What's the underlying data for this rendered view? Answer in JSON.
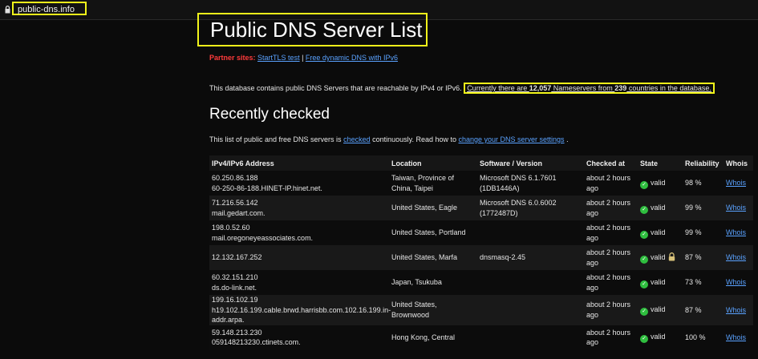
{
  "browser": {
    "url": "public-dns.info"
  },
  "page": {
    "title": "Public DNS Server List",
    "partners_label": "Partner sites:",
    "partner1": "StartTLS test",
    "partner_sep": " | ",
    "partner2": "Free dynamic DNS with IPv6",
    "intro": "This database contains public DNS Servers that are reachable by IPv4 or IPv6.",
    "count_prefix": "Currently there are ",
    "count_servers": "12,057",
    "count_mid": " Nameservers from ",
    "count_countries": "239",
    "count_suffix": " countries in the database.",
    "recent_heading": "Recently checked",
    "desc_prefix": "This list of public and free DNS servers is ",
    "desc_link1": "checked",
    "desc_mid": " continuously. Read how to ",
    "desc_link2": "change your DNS server settings",
    "desc_suffix": " ."
  },
  "table": {
    "headers": [
      "IPv4/IPv6 Address",
      "Location",
      "Software / Version",
      "Checked at",
      "State",
      "Reliability",
      "Whois"
    ],
    "rows": [
      {
        "ip": "60.250.86.188",
        "host": "60-250-86-188.HINET-IP.hinet.net.",
        "location": "Taiwan, Province of China, Taipei",
        "software": "Microsoft DNS 6.1.7601 (1DB1446A)",
        "checked": "about 2 hours ago",
        "state": "valid",
        "reliability": "98 %",
        "whois": "Whois",
        "lock": false
      },
      {
        "ip": "71.216.56.142",
        "host": "mail.gedart.com.",
        "location": "United States, Eagle",
        "software": "Microsoft DNS 6.0.6002 (1772487D)",
        "checked": "about 2 hours ago",
        "state": "valid",
        "reliability": "99 %",
        "whois": "Whois",
        "lock": false
      },
      {
        "ip": "198.0.52.60",
        "host": "mail.oregoneyeassociates.com.",
        "location": "United States, Portland",
        "software": "",
        "checked": "about 2 hours ago",
        "state": "valid",
        "reliability": "99 %",
        "whois": "Whois",
        "lock": false
      },
      {
        "ip": "12.132.167.252",
        "host": "",
        "location": "United States, Marfa",
        "software": "dnsmasq-2.45",
        "checked": "about 2 hours ago",
        "state": "valid",
        "reliability": "87 %",
        "whois": "Whois",
        "lock": true
      },
      {
        "ip": "60.32.151.210",
        "host": "ds.do-link.net.",
        "location": "Japan, Tsukuba",
        "software": "",
        "checked": "about 2 hours ago",
        "state": "valid",
        "reliability": "73 %",
        "whois": "Whois",
        "lock": false
      },
      {
        "ip": "199.16.102.19",
        "host": "h19.102.16.199.cable.brwd.harrisbb.com.102.16.199.in-addr.arpa.",
        "location": "United States, Brownwood",
        "software": "",
        "checked": "about 2 hours ago",
        "state": "valid",
        "reliability": "87 %",
        "whois": "Whois",
        "lock": false
      },
      {
        "ip": "59.148.213.230",
        "host": "059148213230.ctinets.com.",
        "location": "Hong Kong, Central",
        "software": "",
        "checked": "about 2 hours ago",
        "state": "valid",
        "reliability": "100 %",
        "whois": "Whois",
        "lock": false
      }
    ]
  }
}
